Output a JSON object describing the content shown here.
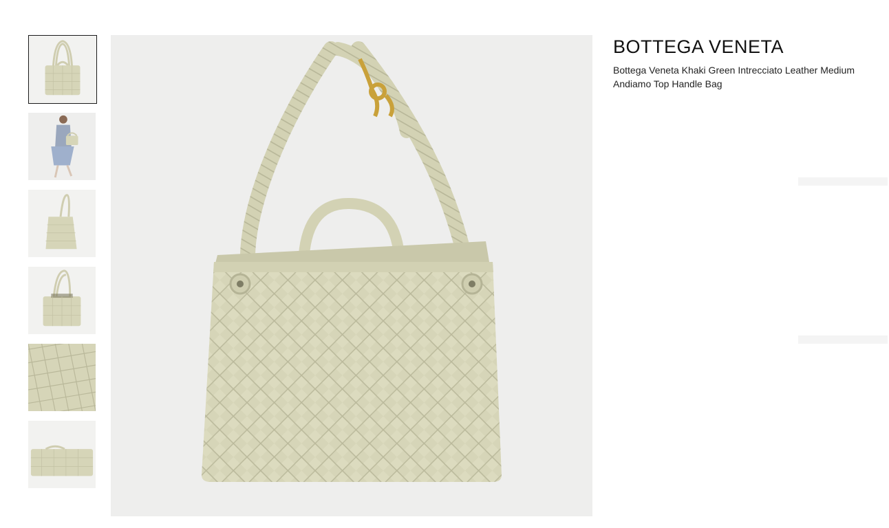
{
  "product": {
    "brand": "BOTTEGA VENETA",
    "name": "Bottega Veneta Khaki Green Intrecciato Leather Medium Andiamo Top Handle Bag"
  },
  "gallery": {
    "selected_index": 0,
    "thumbnails": [
      {
        "view": "front-with-straps-icon"
      },
      {
        "view": "model-carrying-bag-icon"
      },
      {
        "view": "side-view-icon"
      },
      {
        "view": "back-view-icon"
      },
      {
        "view": "weave-detail-icon"
      },
      {
        "view": "base-view-icon"
      }
    ]
  },
  "colors": {
    "leather": "#d6d5b8",
    "leather_shadow": "#b9b89a",
    "hardware_gold": "#c9a13a",
    "background": "#eeeeed",
    "selected_border": "#1a1a1a"
  }
}
